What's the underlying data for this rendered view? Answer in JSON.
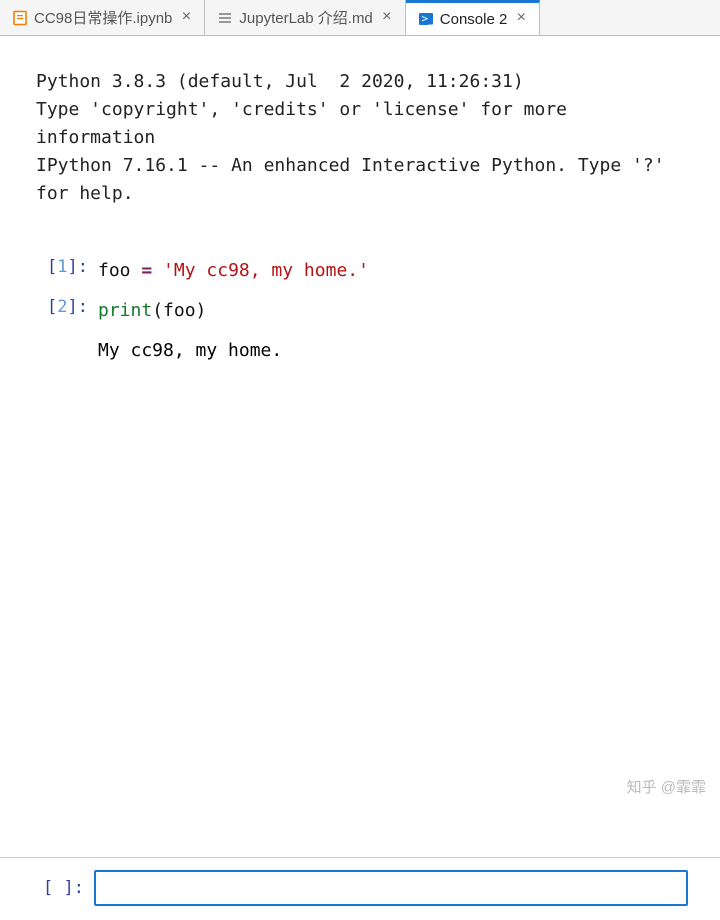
{
  "tabs": [
    {
      "label": "CC98日常操作.ipynb",
      "icon": "notebook-icon",
      "active": false
    },
    {
      "label": "JupyterLab 介绍.md",
      "icon": "markdown-icon",
      "active": false
    },
    {
      "label": "Console 2",
      "icon": "console-icon",
      "active": true
    }
  ],
  "banner": "Python 3.8.3 (default, Jul  2 2020, 11:26:31)\nType 'copyright', 'credits' or 'license' for more information\nIPython 7.16.1 -- An enhanced Interactive Python. Type '?' for help.",
  "cells": [
    {
      "n": "1",
      "tokens": [
        {
          "t": "foo ",
          "c": "name"
        },
        {
          "t": "=",
          "c": "op"
        },
        {
          "t": " ",
          "c": "name"
        },
        {
          "t": "'My cc98, my home.'",
          "c": "str"
        }
      ]
    },
    {
      "n": "2",
      "tokens": [
        {
          "t": "print",
          "c": "func"
        },
        {
          "t": "(",
          "c": "pun"
        },
        {
          "t": "foo",
          "c": "name"
        },
        {
          "t": ")",
          "c": "pun"
        }
      ],
      "output": "My cc98, my home."
    }
  ],
  "input": {
    "prompt": "[ ]:",
    "value": ""
  },
  "watermark": "知乎 @霏霏"
}
